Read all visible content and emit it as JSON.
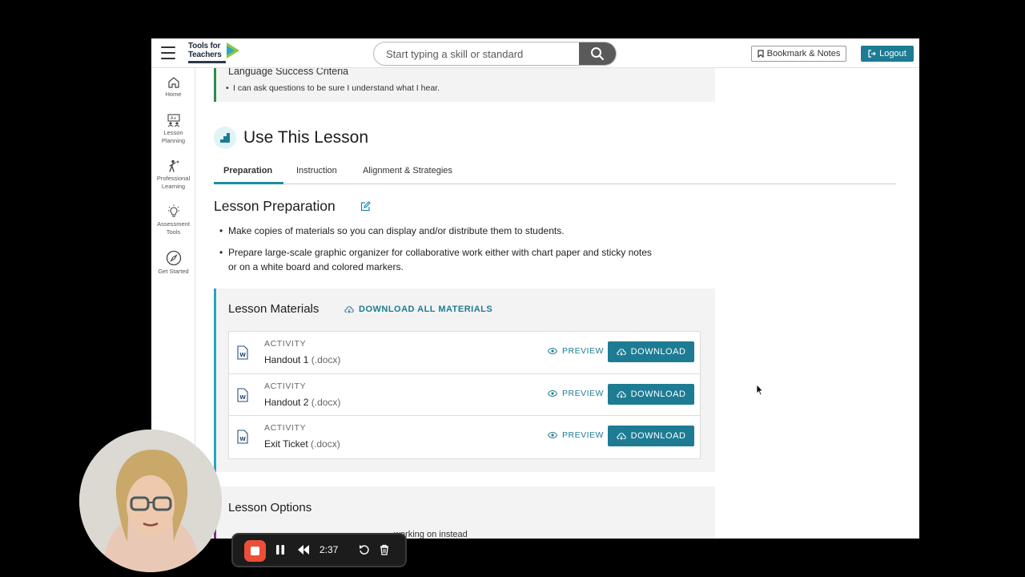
{
  "header": {
    "logo_line1": "Tools for",
    "logo_line2": "Teachers",
    "search": {
      "placeholder": "Start typing a skill or standard"
    },
    "bookmark_label": "Bookmark & Notes",
    "logout_label": "Logout"
  },
  "sidenav": {
    "items": [
      {
        "label": "Home",
        "icon": "home-icon"
      },
      {
        "label": "Lesson Planning",
        "icon": "lesson-planning-icon"
      },
      {
        "label": "Professional Learning",
        "icon": "professional-learning-icon"
      },
      {
        "label": "Assessment Tools",
        "icon": "lightbulb-icon"
      },
      {
        "label": "Get Started",
        "icon": "compass-icon"
      }
    ]
  },
  "language_criteria": {
    "title": "Language Success Criteria",
    "item": "I can ask questions to be sure I understand what I hear."
  },
  "use_lesson": {
    "title": "Use This Lesson",
    "tabs": [
      {
        "label": "Preparation",
        "active": true
      },
      {
        "label": "Instruction",
        "active": false
      },
      {
        "label": "Alignment & Strategies",
        "active": false
      }
    ]
  },
  "preparation": {
    "title": "Lesson Preparation",
    "items": [
      "Make copies of materials so you can display and/or distribute them to students.",
      "Prepare large-scale graphic organizer for collaborative work either with chart paper and sticky notes or on a white board and colored markers."
    ]
  },
  "materials": {
    "title": "Lesson Materials",
    "download_all_label": "DOWNLOAD ALL MATERIALS",
    "preview_label": "PREVIEW",
    "download_label": "DOWNLOAD",
    "rows": [
      {
        "category": "ACTIVITY",
        "name": "Handout 1",
        "ext": "(.docx)"
      },
      {
        "category": "ACTIVITY",
        "name": "Handout 2",
        "ext": "(.docx)"
      },
      {
        "category": "ACTIVITY",
        "name": "Exit Ticket",
        "ext": "(.docx)"
      }
    ]
  },
  "options": {
    "title": "Lesson Options",
    "partial_text": "working on instead"
  },
  "recorder": {
    "time": "2:37"
  },
  "colors": {
    "accent": "#1d7c93",
    "recorder_stop": "#ec4e37"
  }
}
